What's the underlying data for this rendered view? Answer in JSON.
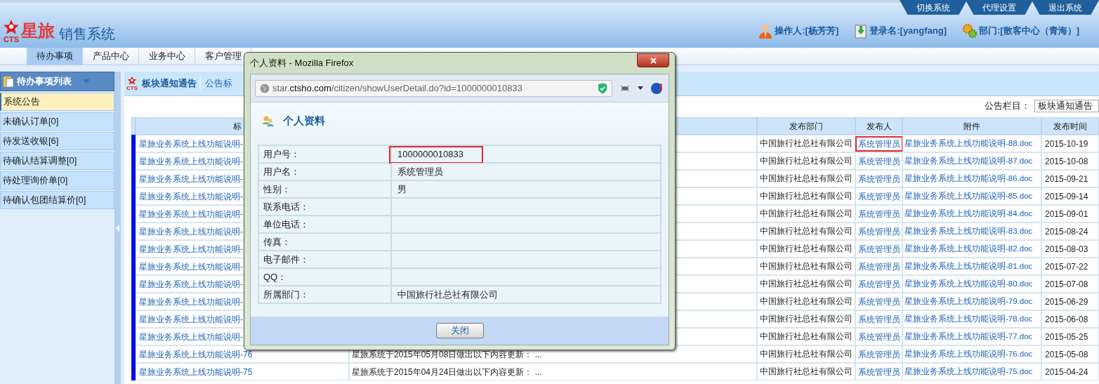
{
  "header": {
    "logo_mark": "CTS",
    "brand": "星旅",
    "title": "销售系统",
    "top_links": [
      "切换系统",
      "代理设置",
      "退出系统"
    ],
    "user_info": [
      {
        "kind": "person",
        "text": "操作人:[杨芳芳]"
      },
      {
        "kind": "login",
        "text": "登录名:[yangfang]"
      },
      {
        "kind": "department",
        "text": "部门:[散客中心（青海）]"
      }
    ]
  },
  "nav_tabs": [
    {
      "label": "待办事项",
      "selected": true
    },
    {
      "label": "产品中心",
      "selected": false
    },
    {
      "label": "业务中心",
      "selected": false
    },
    {
      "label": "客户管理",
      "selected": false
    }
  ],
  "sidebar": {
    "title": "待办事项列表",
    "items": [
      {
        "label": "系统公告",
        "selected": true
      },
      {
        "label": "未确认订单[0]",
        "selected": false
      },
      {
        "label": "待发送收银[6]",
        "selected": false
      },
      {
        "label": "待确认结算调整[0]",
        "selected": false
      },
      {
        "label": "待处理询价单[0]",
        "selected": false
      },
      {
        "label": "待确认包团结算价[0]",
        "selected": false
      }
    ]
  },
  "content": {
    "logo_mark": "CTS",
    "panel_title": "板块通知通告",
    "tab": "公告标",
    "filter_label": "公告栏目：",
    "filter_value": "板块通知通告"
  },
  "table": {
    "columns": {
      "title": "标",
      "department": "发布部门",
      "publisher": "发布人",
      "attachment": "附件",
      "date": "发布时间"
    },
    "rows": [
      {
        "title": "星旅业务系统上线功能说明-",
        "department": "中国旅行社总社有限公司",
        "publisher": "系统管理员",
        "highlighted": true,
        "attachment": "星旅业务系统上线功能说明-88.doc",
        "date": "2015-10-19"
      },
      {
        "title": "星旅业务系统上线功能说明-",
        "department": "中国旅行社总社有限公司",
        "publisher": "系统管理员",
        "highlighted": false,
        "attachment": "星旅业务系统上线功能说明-87.doc",
        "date": "2015-10-08"
      },
      {
        "title": "星旅业务系统上线功能说明-",
        "department": "中国旅行社总社有限公司",
        "publisher": "系统管理员",
        "highlighted": false,
        "attachment": "星旅业务系统上线功能说明-86.doc",
        "date": "2015-09-21"
      },
      {
        "title": "星旅业务系统上线功能说明-",
        "department": "中国旅行社总社有限公司",
        "publisher": "系统管理员",
        "highlighted": false,
        "attachment": "星旅业务系统上线功能说明-85.doc",
        "date": "2015-09-14"
      },
      {
        "title": "星旅业务系统上线功能说明-",
        "department": "中国旅行社总社有限公司",
        "publisher": "系统管理员",
        "highlighted": false,
        "attachment": "星旅业务系统上线功能说明-84.doc",
        "date": "2015-09-01"
      },
      {
        "title": "星旅业务系统上线功能说明-",
        "department": "中国旅行社总社有限公司",
        "publisher": "系统管理员",
        "highlighted": false,
        "attachment": "星旅业务系统上线功能说明-83.doc",
        "date": "2015-08-24"
      },
      {
        "title": "星旅业务系统上线功能说明-",
        "department": "中国旅行社总社有限公司",
        "publisher": "系统管理员",
        "highlighted": false,
        "attachment": "星旅业务系统上线功能说明-82.doc",
        "date": "2015-08-03"
      },
      {
        "title": "星旅业务系统上线功能说明-",
        "department": "中国旅行社总社有限公司",
        "publisher": "系统管理员",
        "highlighted": false,
        "attachment": "星旅业务系统上线功能说明-81.doc",
        "date": "2015-07-22"
      },
      {
        "title": "星旅业务系统上线功能说明-",
        "department": "中国旅行社总社有限公司",
        "publisher": "系统管理员",
        "highlighted": false,
        "attachment": "星旅业务系统上线功能说明-80.doc",
        "date": "2015-07-08"
      },
      {
        "title": "星旅业务系统上线功能说明-",
        "department": "中国旅行社总社有限公司",
        "publisher": "系统管理员",
        "highlighted": false,
        "attachment": "星旅业务系统上线功能说明-79.doc",
        "date": "2015-06-29"
      },
      {
        "title": "星旅业务系统上线功能说明-",
        "department": "中国旅行社总社有限公司",
        "publisher": "系统管理员",
        "highlighted": false,
        "attachment": "星旅业务系统上线功能说明-78.doc",
        "date": "2015-06-08"
      },
      {
        "title": "星旅业务系统上线功能说明-",
        "department": "中国旅行社总社有限公司",
        "publisher": "系统管理员",
        "highlighted": false,
        "attachment": "星旅业务系统上线功能说明-77.doc",
        "date": "2015-05-25"
      },
      {
        "title": "星旅业务系统上线功能说明-76",
        "summary": "星旅系统于2015年05月08日做出以下内容更新： ...",
        "department": "中国旅行社总社有限公司",
        "publisher": "系统管理员",
        "highlighted": false,
        "attachment": "星旅业务系统上线功能说明-76.doc",
        "date": "2015-05-08"
      },
      {
        "title": "星旅业务系统上线功能说明-75",
        "summary": "星旅系统于2015年04月24日做出以下内容更新： ...",
        "department": "中国旅行社总社有限公司",
        "publisher": "系统管理员",
        "highlighted": false,
        "attachment": "星旅业务系统上线功能说明-75.doc",
        "date": "2015-04-24"
      }
    ]
  },
  "popup": {
    "window_title": "个人资料 - Mozilla Firefox",
    "url": "star.**ctsho.com**/citizen/showUserDetail.do?id=1000000010833",
    "heading": "个人资料",
    "fields": [
      {
        "label": "用户号：",
        "value": "1000000010833",
        "highlighted": true
      },
      {
        "label": "用户名：",
        "value": "系统管理员",
        "highlighted": false
      },
      {
        "label": "性别：",
        "value": "男",
        "highlighted": false
      },
      {
        "label": "联系电话：",
        "highlighted": false
      },
      {
        "label": "单位电话：",
        "highlighted": false
      },
      {
        "label": "传真：",
        "highlighted": false
      },
      {
        "label": "电子邮件：",
        "highlighted": false
      },
      {
        "label": "QQ：",
        "highlighted": false
      },
      {
        "label": "所属部门：",
        "value": "中国旅行社总社有限公司",
        "highlighted": false
      }
    ],
    "close_button": "关闭"
  }
}
